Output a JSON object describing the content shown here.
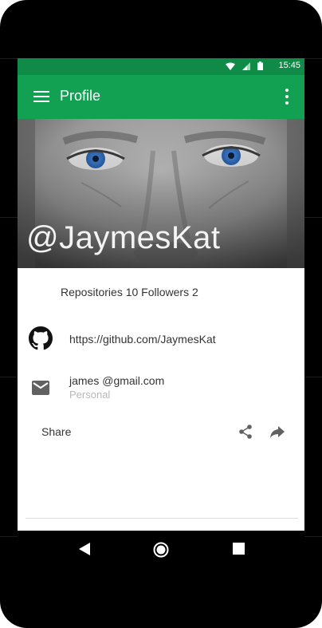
{
  "status_bar": {
    "time": "15:45",
    "icons": [
      "wifi-icon",
      "signal-icon",
      "battery-icon"
    ]
  },
  "app_bar": {
    "title": "Profile",
    "menu_icon": "hamburger-menu-icon",
    "overflow_icon": "more-vertical-icon"
  },
  "profile": {
    "handle": "@JaymesKat",
    "stats": "Repositories 10 Followers 2",
    "github_url": "https://github.com/JaymesKat",
    "email": "james @gmail.com",
    "email_type": "Personal"
  },
  "share": {
    "label": "Share",
    "icons": [
      "share-icon",
      "forward-icon"
    ]
  },
  "navigation": {
    "buttons": [
      "back-icon",
      "home-icon",
      "recents-icon"
    ]
  },
  "colors": {
    "status_bar": "#0f8a47",
    "app_bar": "#12a052",
    "text_primary": "#333333",
    "text_secondary": "#b8b8b8"
  }
}
